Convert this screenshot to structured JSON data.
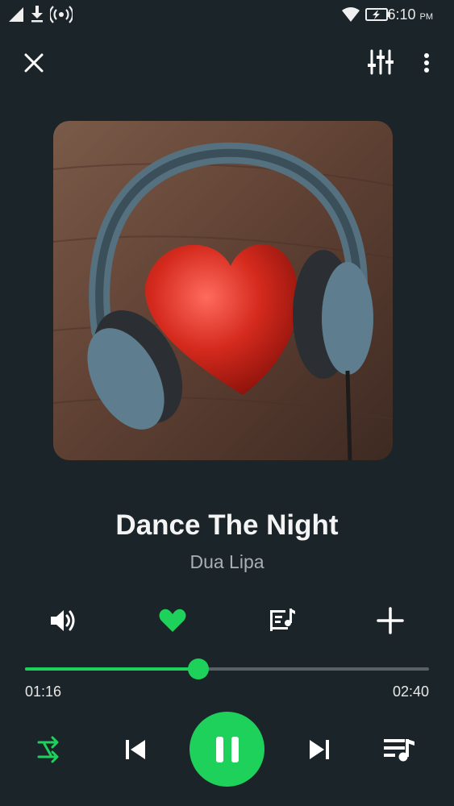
{
  "status_bar": {
    "time": "6:10",
    "ampm": "PM"
  },
  "song": {
    "title": "Dance The Night",
    "artist": "Dua Lipa"
  },
  "progress": {
    "elapsed": "01:16",
    "duration": "02:40",
    "fraction": 0.43
  },
  "colors": {
    "accent": "#1ed15a",
    "background": "#1b2429",
    "artist_text": "#a9afb3"
  },
  "icons": {
    "close": "close-icon",
    "equalizer": "equalizer-icon",
    "more": "more-vert-icon",
    "volume": "volume-icon",
    "favorite": "heart-icon",
    "lyrics": "lyrics-icon",
    "add": "plus-icon",
    "shuffle": "shuffle-icon",
    "previous": "skip-previous-icon",
    "pause": "pause-icon",
    "next": "skip-next-icon",
    "queue": "queue-music-icon"
  }
}
